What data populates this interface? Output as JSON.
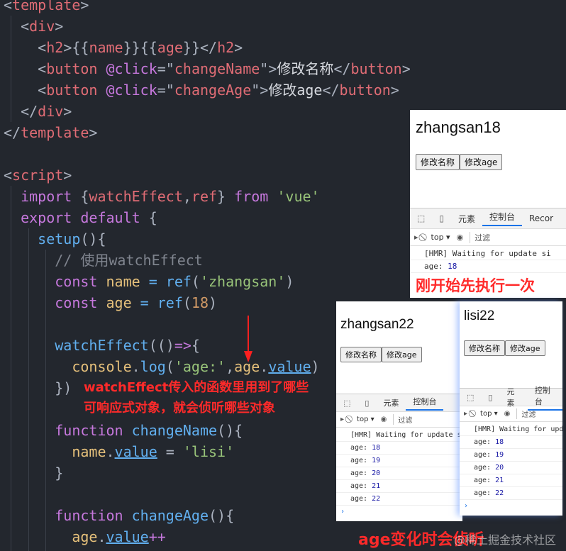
{
  "code": [
    [
      [
        "t-p",
        "<"
      ],
      [
        "t-tag",
        "template"
      ],
      [
        "t-p",
        ">"
      ]
    ],
    [
      [
        "t-p",
        "  <"
      ],
      [
        "t-tag",
        "div"
      ],
      [
        "t-p",
        ">"
      ]
    ],
    [
      [
        "t-p",
        "    <"
      ],
      [
        "t-tag",
        "h2"
      ],
      [
        "t-p",
        ">{{"
      ],
      [
        "t-tag",
        "name"
      ],
      [
        "t-p",
        "}}{{"
      ],
      [
        "t-tag",
        "age"
      ],
      [
        "t-p",
        "}}</"
      ],
      [
        "t-tag",
        "h2"
      ],
      [
        "t-p",
        ">"
      ]
    ],
    [
      [
        "t-p",
        "    <"
      ],
      [
        "t-tag",
        "button"
      ],
      [
        "t-p",
        " "
      ],
      [
        "t-kw",
        "@click"
      ],
      [
        "t-p",
        "=\""
      ],
      [
        "t-tag",
        "changeName"
      ],
      [
        "t-p",
        "\">"
      ],
      [
        "t-txt",
        "修改名称"
      ],
      [
        "t-p",
        "</"
      ],
      [
        "t-tag",
        "button"
      ],
      [
        "t-p",
        ">"
      ]
    ],
    [
      [
        "t-p",
        "    <"
      ],
      [
        "t-tag",
        "button"
      ],
      [
        "t-p",
        " "
      ],
      [
        "t-kw",
        "@click"
      ],
      [
        "t-p",
        "=\""
      ],
      [
        "t-tag",
        "changeAge"
      ],
      [
        "t-p",
        "\">"
      ],
      [
        "t-txt",
        "修改age"
      ],
      [
        "t-p",
        "</"
      ],
      [
        "t-tag",
        "button"
      ],
      [
        "t-p",
        ">"
      ]
    ],
    [
      [
        "t-p",
        "  </"
      ],
      [
        "t-tag",
        "div"
      ],
      [
        "t-p",
        ">"
      ]
    ],
    [
      [
        "t-p",
        "</"
      ],
      [
        "t-tag",
        "template"
      ],
      [
        "t-p",
        ">"
      ]
    ],
    [],
    [
      [
        "t-p",
        "<"
      ],
      [
        "t-tag",
        "script"
      ],
      [
        "t-p",
        ">"
      ]
    ],
    [
      [
        "t-kw",
        "  import "
      ],
      [
        "t-p",
        "{"
      ],
      [
        "t-red",
        "watchEffect"
      ],
      [
        "t-p",
        ","
      ],
      [
        "t-red",
        "ref"
      ],
      [
        "t-p",
        "} "
      ],
      [
        "t-kw",
        "from "
      ],
      [
        "t-str",
        "'vue'"
      ]
    ],
    [
      [
        "t-kw",
        "  export default "
      ],
      [
        "t-p",
        "{"
      ]
    ],
    [
      [
        "t-fn",
        "    setup"
      ],
      [
        "t-p",
        "(){"
      ]
    ],
    [
      [
        "t-com",
        "      // 使用watchEffect"
      ]
    ],
    [
      [
        "t-kw",
        "      const "
      ],
      [
        "t-var",
        "name"
      ],
      [
        "t-fn",
        " = ref"
      ],
      [
        "t-p",
        "("
      ],
      [
        "t-str",
        "'zhangsan'"
      ],
      [
        "t-p",
        ")"
      ]
    ],
    [
      [
        "t-kw",
        "      const "
      ],
      [
        "t-var",
        "age"
      ],
      [
        "t-fn",
        " = ref"
      ],
      [
        "t-p",
        "("
      ],
      [
        "t-num",
        "18"
      ],
      [
        "t-p",
        ")"
      ]
    ],
    [],
    [
      [
        "t-fn",
        "      watchEffect"
      ],
      [
        "t-p",
        "(()"
      ],
      [
        "t-kw",
        "=>"
      ],
      [
        "t-p",
        "{"
      ]
    ],
    [
      [
        "t-var",
        "        console"
      ],
      [
        "t-p",
        "."
      ],
      [
        "t-fn",
        "log"
      ],
      [
        "t-p",
        "("
      ],
      [
        "t-str",
        "'age:'"
      ],
      [
        "t-p",
        ","
      ],
      [
        "t-var",
        "age"
      ],
      [
        "t-p",
        "."
      ],
      [
        "t-prop",
        "value"
      ],
      [
        "t-p",
        ")"
      ]
    ],
    [
      [
        "t-p",
        "      })"
      ]
    ],
    [],
    [
      [
        "t-kw",
        "      function "
      ],
      [
        "t-fn",
        "changeName"
      ],
      [
        "t-p",
        "(){"
      ]
    ],
    [
      [
        "t-var",
        "        name"
      ],
      [
        "t-p",
        "."
      ],
      [
        "t-prop",
        "value"
      ],
      [
        "t-p",
        " = "
      ],
      [
        "t-str",
        "'lisi'"
      ]
    ],
    [
      [
        "t-p",
        "      }"
      ]
    ],
    [],
    [
      [
        "t-kw",
        "      function "
      ],
      [
        "t-fn",
        "changeAge"
      ],
      [
        "t-p",
        "(){"
      ]
    ],
    [
      [
        "t-var",
        "        age"
      ],
      [
        "t-p",
        "."
      ],
      [
        "t-prop",
        "value"
      ],
      [
        "t-kw",
        "++"
      ]
    ]
  ],
  "annotations": {
    "line1": "watchEffect传入的函数里用到了哪些",
    "line2": "可响应式对象，就会侦听哪些对象",
    "first_run": "刚开始先执行一次",
    "age_change": "age变化时会侦听",
    "watermark": "@稀土掘金技术社区"
  },
  "devtools": {
    "tab_elements": "元素",
    "tab_console": "控制台",
    "tab_recorder": "Recor",
    "context": "top ▾",
    "filter": "过滤",
    "hmr": "[HMR] Waiting for update si",
    "log_label": "age:"
  },
  "panels": [
    {
      "title": "zhangsan18",
      "btn_name": "修改名称",
      "btn_age": "修改age",
      "logs": [
        "18"
      ]
    },
    {
      "title": "zhangsan22",
      "btn_name": "修改名称",
      "btn_age": "修改age",
      "logs": [
        "18",
        "19",
        "20",
        "21",
        "22"
      ]
    },
    {
      "title": "lisi22",
      "btn_name": "修改名称",
      "btn_age": "修改age",
      "logs": [
        "18",
        "19",
        "20",
        "21",
        "22"
      ]
    }
  ]
}
